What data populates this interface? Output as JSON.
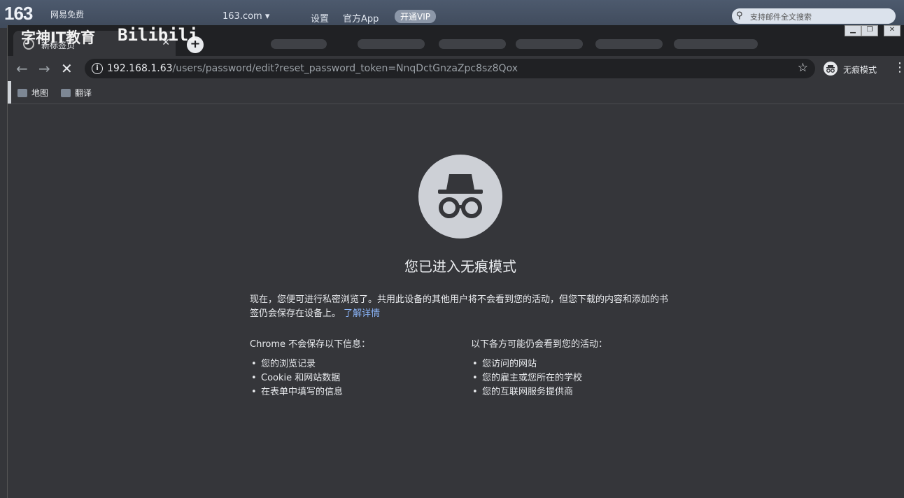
{
  "background_site": {
    "logo": "163",
    "logo_sub": "网易免费",
    "domain": "163.com ▾",
    "settings": "设置",
    "app": "官方App",
    "vip": "开通VIP",
    "search_placeholder": "支持邮件全文搜索"
  },
  "watermark": {
    "text": "字神IT教育",
    "tag": "Bilibili"
  },
  "tab": {
    "title": "新标签页"
  },
  "toolbar": {
    "url_host": "192.168.1.63",
    "url_path": "/users/password/edit?reset_password_token=NnqDctGnzaZpc8sz8Qox",
    "incognito_label": "无痕模式"
  },
  "bookmarks": [
    {
      "label": "地图"
    },
    {
      "label": "翻译"
    }
  ],
  "page": {
    "heading": "您已进入无痕模式",
    "paragraph": "现在，您便可进行私密浏览了。共用此设备的其他用户将不会看到您的活动，但您下载的内容和添加的书签仍会保存在设备上。",
    "learn_more": "了解详情",
    "left_title": "Chrome 不会保存以下信息：",
    "left_items": [
      "您的浏览记录",
      "Cookie 和网站数据",
      "在表单中填写的信息"
    ],
    "right_title": "以下各方可能仍会看到您的活动：",
    "right_items": [
      "您访问的网站",
      "您的雇主或您所在的学校",
      "您的互联网服务提供商"
    ]
  },
  "colors": {
    "page_bg": "#35363a",
    "tabstrip_bg": "#202124",
    "text": "#e8eaed",
    "link": "#8ab4f8",
    "icon_circle": "#cdd0d6"
  }
}
